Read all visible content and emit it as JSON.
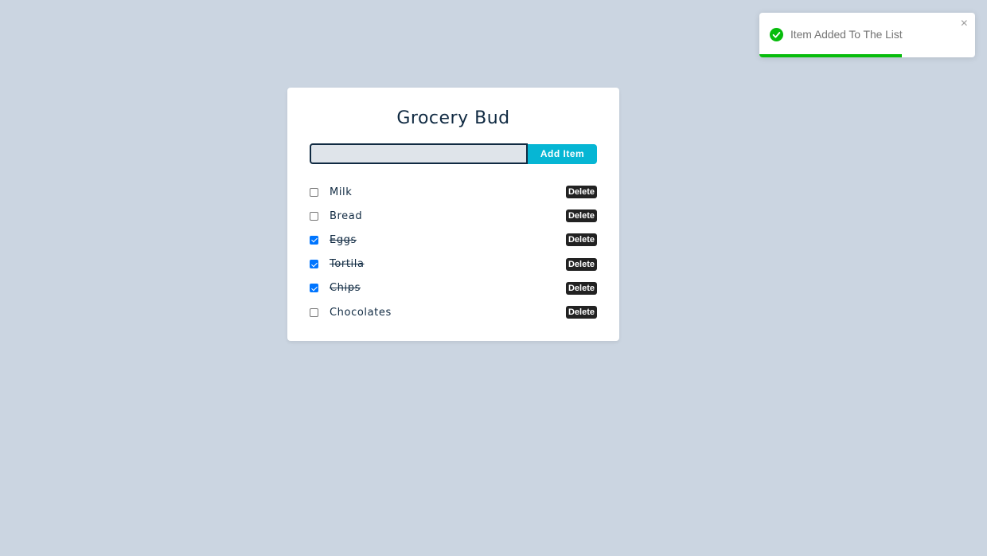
{
  "toast": {
    "message": "Item Added To The List",
    "close_label": "×",
    "icon": "check-circle-icon",
    "progress": 0.66,
    "color": "#07bc0c"
  },
  "app": {
    "title": "Grocery Bud",
    "input_value": "",
    "add_label": "Add Item"
  },
  "items": [
    {
      "name": "Milk",
      "completed": false,
      "delete_label": "Delete"
    },
    {
      "name": "Bread",
      "completed": false,
      "delete_label": "Delete"
    },
    {
      "name": "Eggs",
      "completed": true,
      "delete_label": "Delete"
    },
    {
      "name": "Tortila",
      "completed": true,
      "delete_label": "Delete"
    },
    {
      "name": "Chips",
      "completed": true,
      "delete_label": "Delete"
    },
    {
      "name": "Chocolates",
      "completed": false,
      "delete_label": "Delete"
    }
  ],
  "colors": {
    "background": "#cbd5e1",
    "accent": "#06b6d4",
    "checkbox_checked": "#0075ff",
    "delete_button": "#222222"
  }
}
